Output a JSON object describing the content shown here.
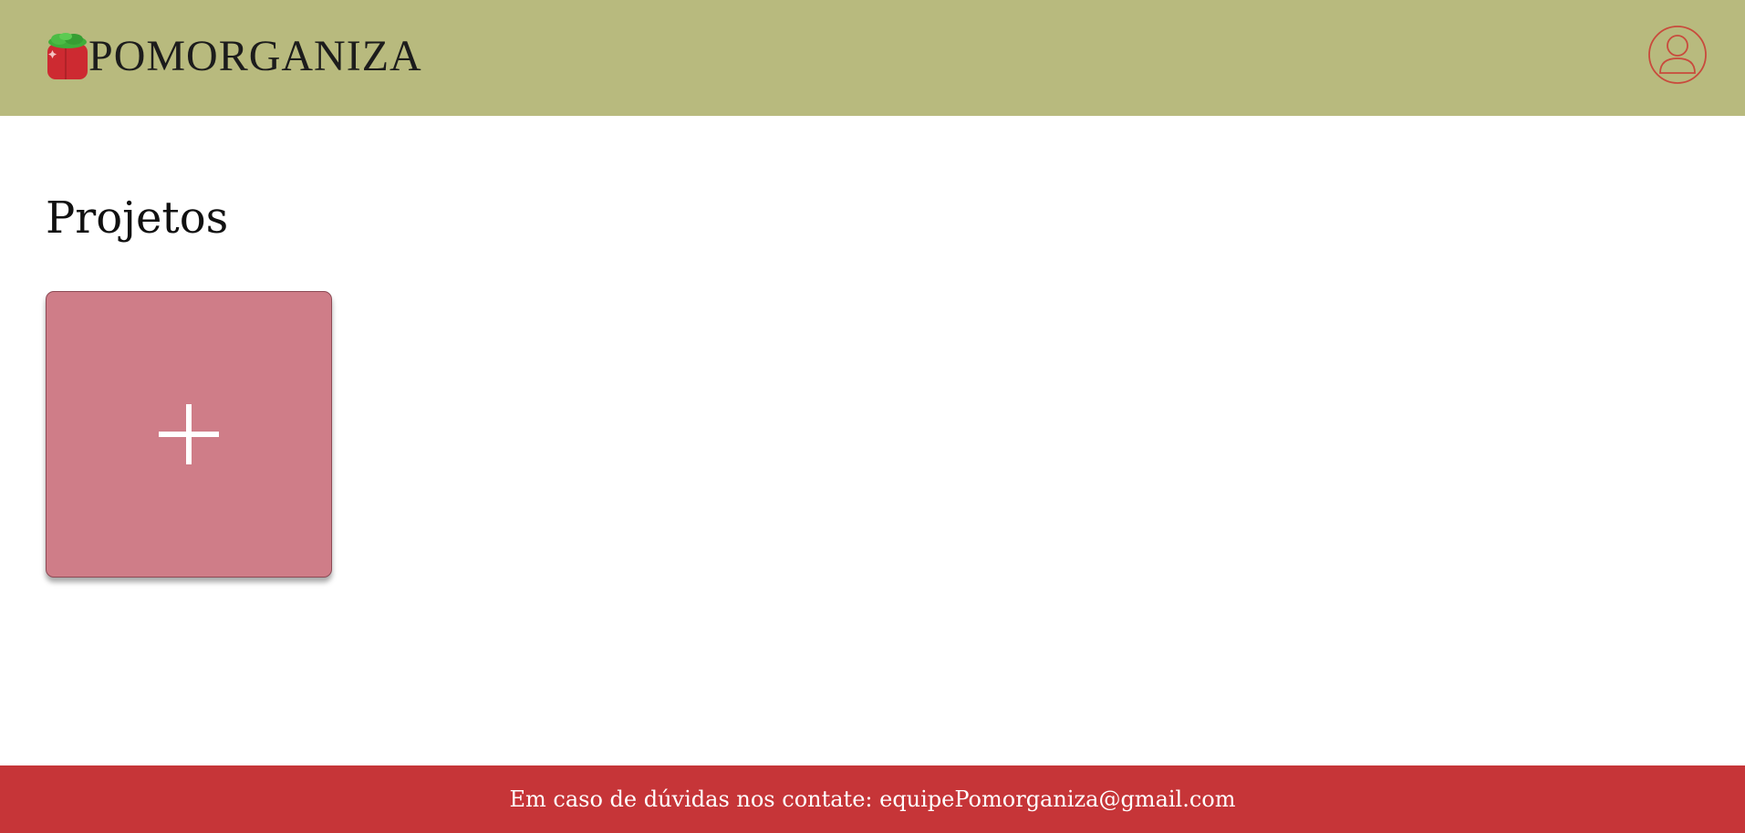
{
  "header": {
    "brand": "POMORGANIZA",
    "logo_icon": "tomato-icon",
    "profile_icon": "user-profile-icon"
  },
  "main": {
    "title": "Projetos",
    "add_card_icon": "plus-icon"
  },
  "footer": {
    "contact_text": "Em caso de dúvidas nos contate: equipePomorganiza@gmail.com"
  },
  "colors": {
    "header_bg": "#b8ba7e",
    "accent_red": "#c63538",
    "card_bg": "#cf7d88",
    "leaf_green": "#3fae3a"
  }
}
